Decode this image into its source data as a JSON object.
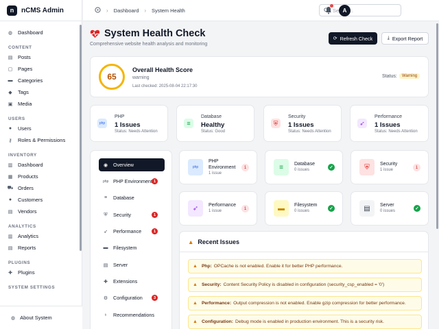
{
  "brand": {
    "logo": "n",
    "name": "nCMS Admin"
  },
  "sidebar": {
    "dashboard": "Dashboard",
    "sections": [
      {
        "title": "CONTENT",
        "items": [
          "Posts",
          "Pages",
          "Categories",
          "Tags",
          "Media"
        ]
      },
      {
        "title": "USERS",
        "items": [
          "Users",
          "Roles & Permissions"
        ]
      },
      {
        "title": "INVENTORY",
        "items": [
          "Dashboard",
          "Products",
          "Orders",
          "Customers",
          "Vendors"
        ]
      },
      {
        "title": "ANALYTICS",
        "items": [
          "Analytics",
          "Reports"
        ]
      },
      {
        "title": "PLUGINS",
        "items": [
          "Plugins"
        ]
      },
      {
        "title": "SYSTEM SETTINGS",
        "items": []
      }
    ],
    "about": "About System"
  },
  "topbar": {
    "breadcrumb": [
      "Dashboard",
      "System Health"
    ],
    "search_placeholder": "Search...",
    "avatar": "A"
  },
  "header": {
    "title": "System Health Check",
    "subtitle": "Comprehensive website health analysis and monitoring",
    "refresh_label": "Refresh Check",
    "export_label": "Export Report"
  },
  "overall": {
    "score": "65",
    "title": "Overall Health Score",
    "state": "warning",
    "last_checked": "Last checked: 2025-08-04 22:17:30",
    "status_label": "Status:",
    "status_badge": "Warning"
  },
  "summary": [
    {
      "name": "PHP",
      "value": "1 Issues",
      "status": "Status: Needs Attention",
      "icon": "php-icon",
      "color": "#dbeafe",
      "fg": "#2563eb",
      "glyph": "php"
    },
    {
      "name": "Database",
      "value": "Healthy",
      "status": "Status: Good",
      "icon": "database-icon",
      "color": "#dcfce7",
      "fg": "#16a34a",
      "glyph": "≡"
    },
    {
      "name": "Security",
      "value": "1 Issues",
      "status": "Status: Needs Attention",
      "icon": "shield-icon",
      "color": "#fee2e2",
      "fg": "#dc2626",
      "glyph": "⛨"
    },
    {
      "name": "Performance",
      "value": "1 Issues",
      "status": "Status: Needs Attention",
      "icon": "rocket-icon",
      "color": "#f3e8ff",
      "fg": "#9333ea",
      "glyph": "➶"
    }
  ],
  "tabs": [
    {
      "label": "Overview",
      "count": ""
    },
    {
      "label": "PHP Environment",
      "count": "1"
    },
    {
      "label": "Database",
      "count": ""
    },
    {
      "label": "Security",
      "count": "1"
    },
    {
      "label": "Performance",
      "count": "1"
    },
    {
      "label": "Filesystem",
      "count": ""
    },
    {
      "label": "Server",
      "count": ""
    },
    {
      "label": "Extensions",
      "count": ""
    },
    {
      "label": "Configuration",
      "count": "3"
    },
    {
      "label": "Recommendations",
      "count": ""
    }
  ],
  "checks": [
    {
      "name": "PHP Environment",
      "sub": "1 issue",
      "count": "1",
      "ok": false
    },
    {
      "name": "Database",
      "sub": "0 issues",
      "count": "",
      "ok": true
    },
    {
      "name": "Security",
      "sub": "1 issue",
      "count": "1",
      "ok": false
    },
    {
      "name": "Performance",
      "sub": "1 issue",
      "count": "1",
      "ok": false
    },
    {
      "name": "Filesystem",
      "sub": "0 issues",
      "count": "",
      "ok": true
    },
    {
      "name": "Server",
      "sub": "0 issues",
      "count": "",
      "ok": true
    }
  ],
  "issues": {
    "title": "Recent Issues",
    "items": [
      {
        "category": "Php:",
        "text": "OPCache is not enabled. Enable it for better PHP performance."
      },
      {
        "category": "Security:",
        "text": "Content Security Policy is disabled in configuration (security_csp_enabled = '0')"
      },
      {
        "category": "Performance:",
        "text": "Output compression is not enabled. Enable gzip compression for better performance."
      },
      {
        "category": "Configuration:",
        "text": "Debug mode is enabled in production environment. This is a security risk."
      }
    ]
  },
  "colors": {
    "primary": "#111827",
    "warning": "#f5b400",
    "danger": "#dc2626",
    "success": "#16a34a"
  }
}
